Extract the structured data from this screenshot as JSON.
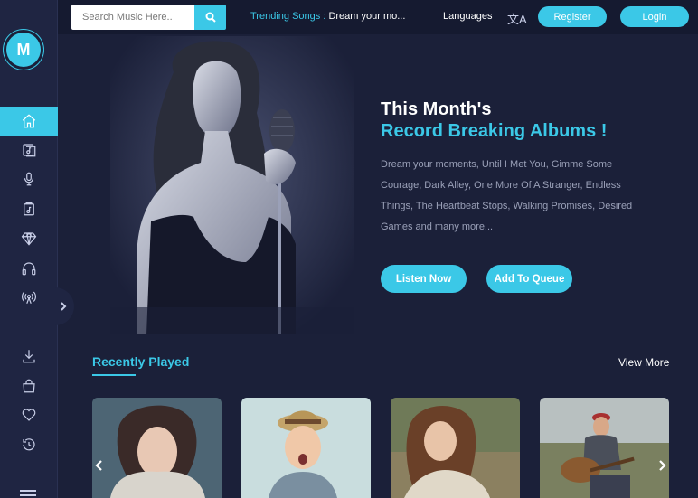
{
  "logo": {
    "letter": "M"
  },
  "sidebar": {
    "items": [
      {
        "icon": "home-icon",
        "active": true
      },
      {
        "icon": "album-icon"
      },
      {
        "icon": "microphone-icon"
      },
      {
        "icon": "music-file-icon"
      },
      {
        "icon": "diamond-icon"
      },
      {
        "icon": "headphones-icon"
      },
      {
        "icon": "radio-icon"
      },
      {
        "icon": "download-icon"
      },
      {
        "icon": "shopping-bag-icon"
      },
      {
        "icon": "heart-icon"
      },
      {
        "icon": "history-icon"
      }
    ]
  },
  "search": {
    "placeholder": "Search Music Here.."
  },
  "trending": {
    "label": "Trending Songs :",
    "song": "Dream your mo..."
  },
  "header": {
    "languages_label": "Languages",
    "register_label": "Register",
    "login_label": "Login"
  },
  "hero": {
    "title_line1": "This Month's",
    "title_line2": "Record Breaking Albums !",
    "description": "Dream your moments, Until I Met You, Gimme Some Courage, Dark Alley, One More Of A Stranger, Endless Things, The Heartbeat Stops, Walking Promises, Desired Games and many more...",
    "listen_now_label": "Listen Now",
    "add_to_queue_label": "Add To Queue"
  },
  "recently_played": {
    "title": "Recently Played",
    "view_more_label": "View More"
  },
  "colors": {
    "accent": "#3bc8e7",
    "background": "#1b2039",
    "sidebar": "#1f2542",
    "topbar": "#151a30"
  }
}
